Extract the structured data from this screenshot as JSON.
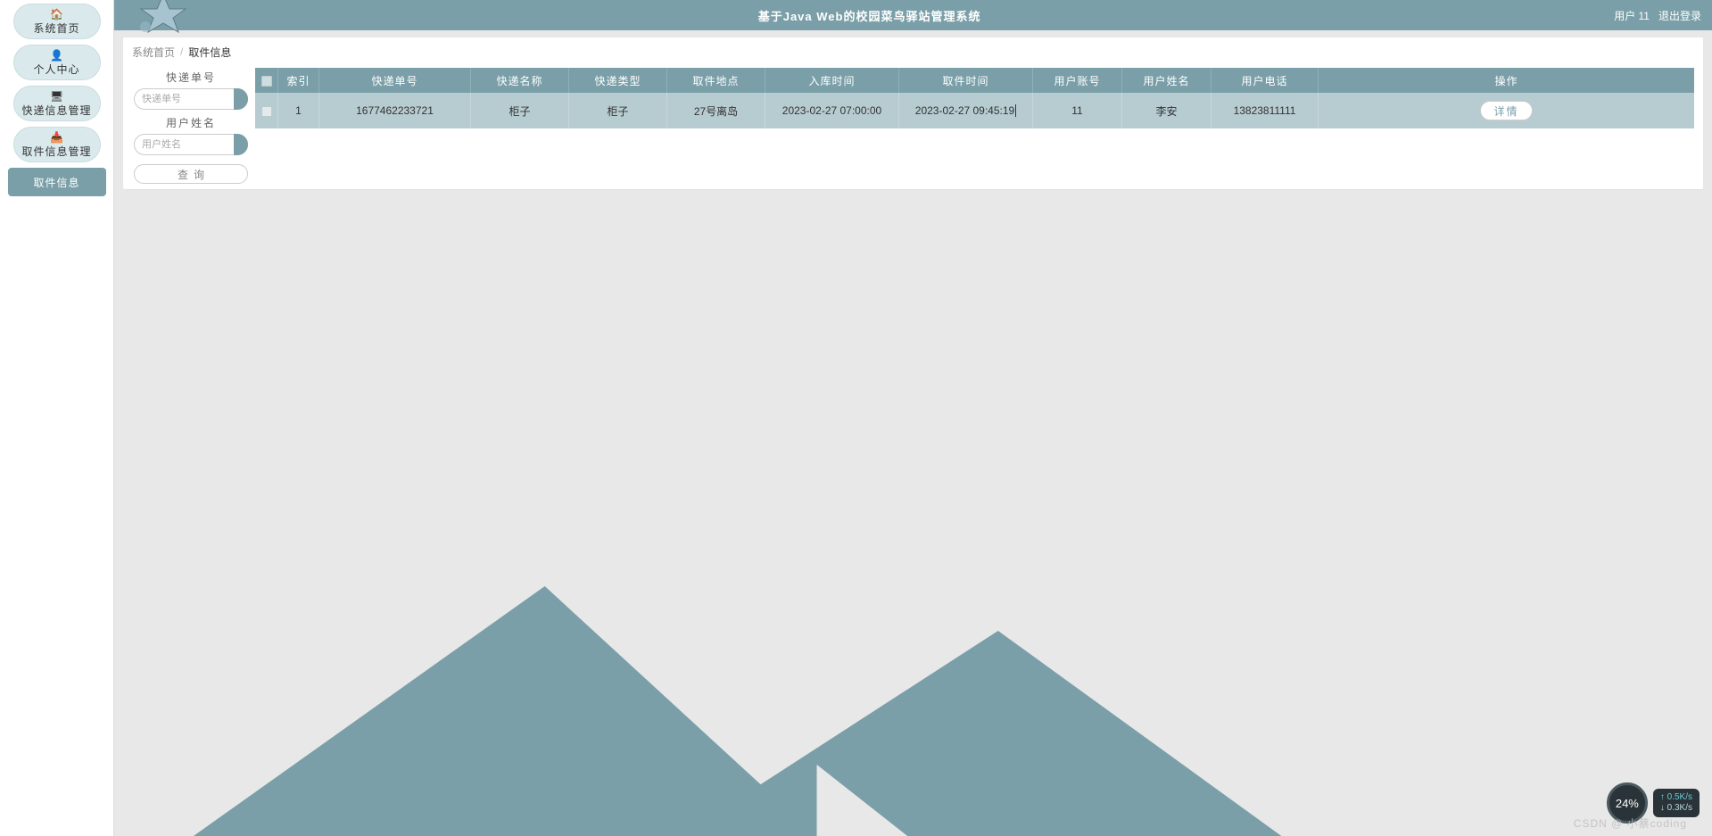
{
  "header": {
    "title": "基于Java Web的校园菜鸟驿站管理系统",
    "user": "用户 11",
    "logout": "退出登录"
  },
  "sidebar": {
    "items": [
      {
        "icon": "home-icon",
        "glyph": "🏠",
        "label": "系统首页"
      },
      {
        "icon": "user-icon",
        "glyph": "👤",
        "label": "个人中心"
      },
      {
        "icon": "storage-icon",
        "glyph": "🖥",
        "label": "快递信息管理"
      },
      {
        "icon": "inbox-icon",
        "glyph": "📥",
        "label": "取件信息管理"
      }
    ],
    "active": {
      "label": "取件信息"
    }
  },
  "breadcrumb": {
    "root": "系统首页",
    "sep": "/",
    "current": "取件信息"
  },
  "filters": {
    "field1_label": "快递单号",
    "field1_ph": "快递单号",
    "field2_label": "用户姓名",
    "field2_ph": "用户姓名",
    "submit": "查询"
  },
  "table": {
    "headers": [
      "",
      "索引",
      "快递单号",
      "快递名称",
      "快递类型",
      "取件地点",
      "入库时间",
      "取件时间",
      "用户账号",
      "用户姓名",
      "用户电话",
      "操作"
    ],
    "rows": [
      {
        "index": "1",
        "danhao": "1677462233721",
        "mingcheng": "柜子",
        "leixing": "柜子",
        "didian": "27号离岛",
        "ruku": "2023-02-27 07:00:00",
        "quijian": "2023-02-27 09:45:19",
        "zhanghao": "11",
        "xingming": "李安",
        "dianhua": "13823811111",
        "op_label": "详情"
      }
    ]
  },
  "widget": {
    "percent": "24%",
    "up": "↑ 0.5K/s",
    "down": "↓ 0.3K/s"
  },
  "watermark": "CSDN @ 小蔡coding"
}
